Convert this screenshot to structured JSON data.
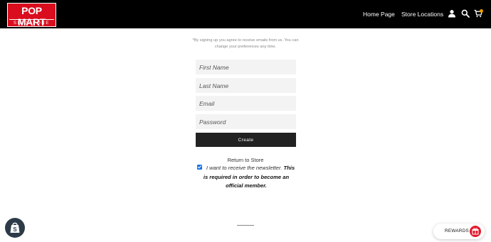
{
  "header": {
    "logo": {
      "main": "POP MART",
      "sub": "SINGAPORE"
    },
    "nav": [
      {
        "label": "Home Page"
      },
      {
        "label": "Store Locations"
      }
    ],
    "icons": [
      "account-icon",
      "search-icon",
      "cart-icon"
    ],
    "background_color": "#000000",
    "brand_color": "#d90d1e",
    "cart_badge_color": "#e8a000"
  },
  "form": {
    "disclaimer": "*By signing up you agree to receive emails from us. You can change your preferences any time.",
    "fields": {
      "first_name_placeholder": "First Name",
      "last_name_placeholder": "Last Name",
      "email_placeholder": "Email",
      "password_placeholder": "Password"
    },
    "create_label": "Create",
    "return_label": "Return to Store",
    "newsletter_checked": true,
    "newsletter_text": "I want to receive the newsletter.",
    "newsletter_required": "This is required in order to become an official member."
  },
  "widgets": {
    "rewards_label": "REWARDS",
    "rewards_color": "#e11b2c",
    "shopify_badge_color": "#2c3b47"
  }
}
